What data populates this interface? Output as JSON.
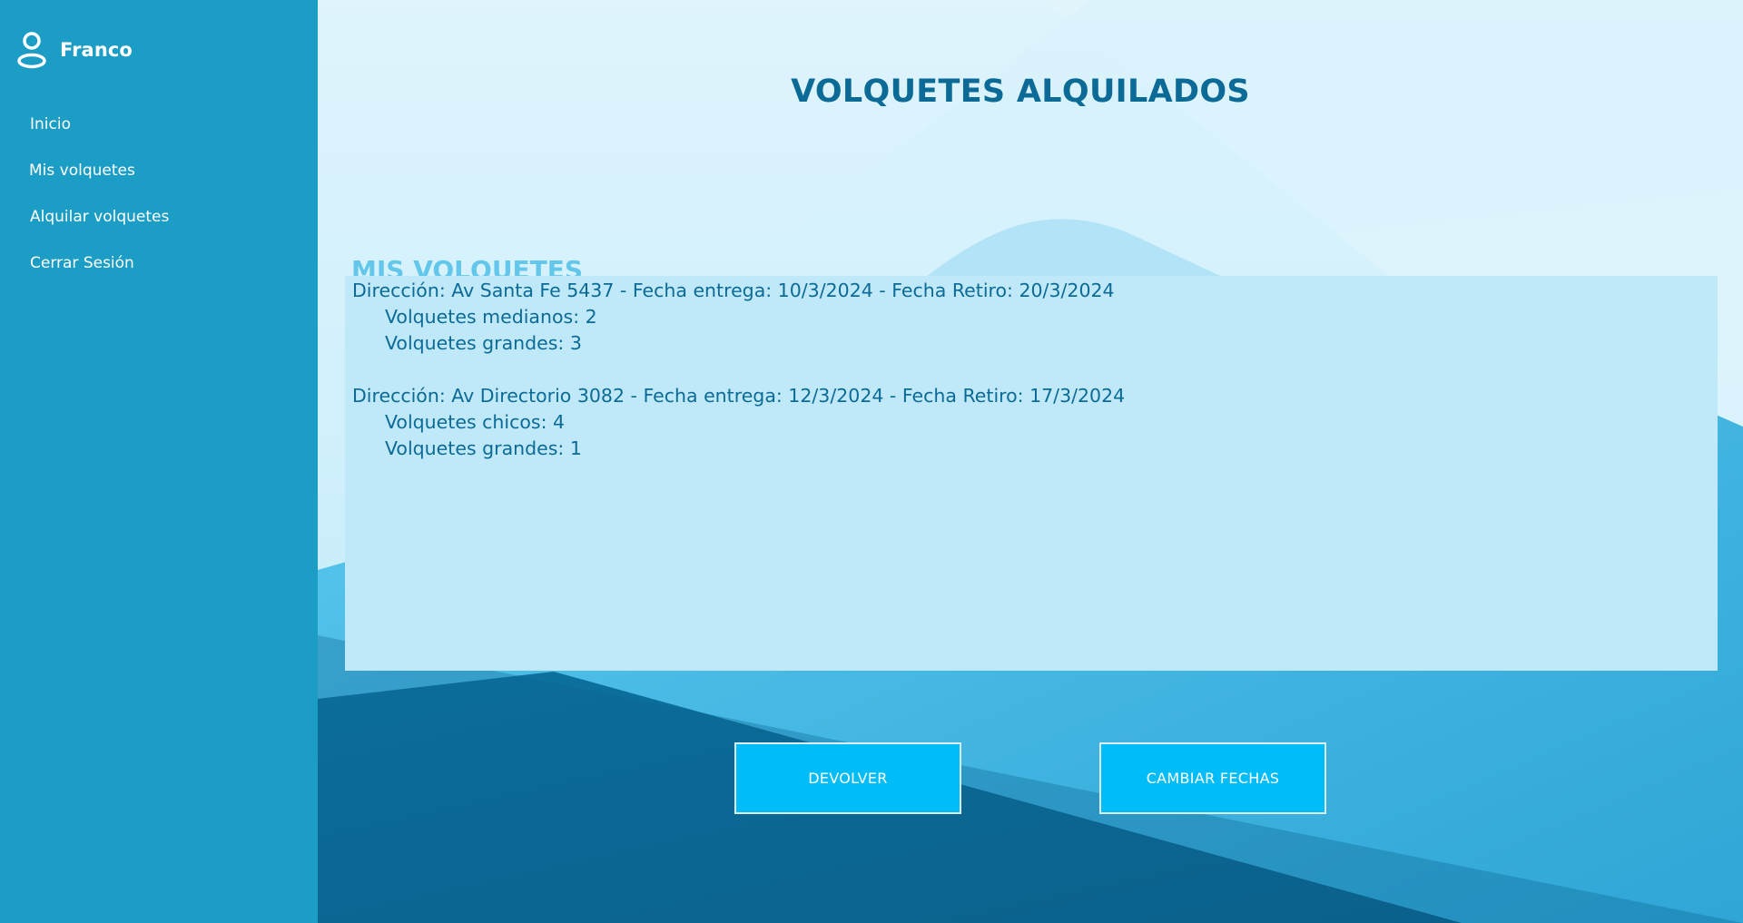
{
  "sidebar": {
    "user_name": "Franco",
    "user_icon": "person-icon",
    "items": [
      {
        "label": "Inicio"
      },
      {
        "label": "Mis volquetes"
      },
      {
        "label": "Alquilar volquetes"
      },
      {
        "label": "Cerrar Sesión"
      }
    ]
  },
  "main": {
    "title": "VOLQUETES ALQUILADOS",
    "section_title": "MIS VOLQUETES",
    "rentals": [
      {
        "header": "Dirección: Av Santa Fe 5437 - Fecha entrega: 10/3/2024 - Fecha Retiro: 20/3/2024",
        "lines": [
          "Volquetes medianos: 2",
          "Volquetes grandes: 3"
        ]
      },
      {
        "header": "Dirección: Av Directorio 3082 - Fecha entrega: 12/3/2024 - Fecha Retiro: 17/3/2024",
        "lines": [
          "Volquetes chicos: 4",
          "Volquetes grandes: 1"
        ]
      }
    ],
    "buttons": {
      "return_label": "DEVOLVER",
      "change_dates_label": "CAMBIAR FECHAS"
    }
  },
  "colors": {
    "sidebar": "#1b9dc6",
    "title": "#0c6b96",
    "section_title": "#62c7ea",
    "list_background": "#bfe8f8",
    "button": "#00bdfa",
    "button_border": "#dcefff"
  }
}
